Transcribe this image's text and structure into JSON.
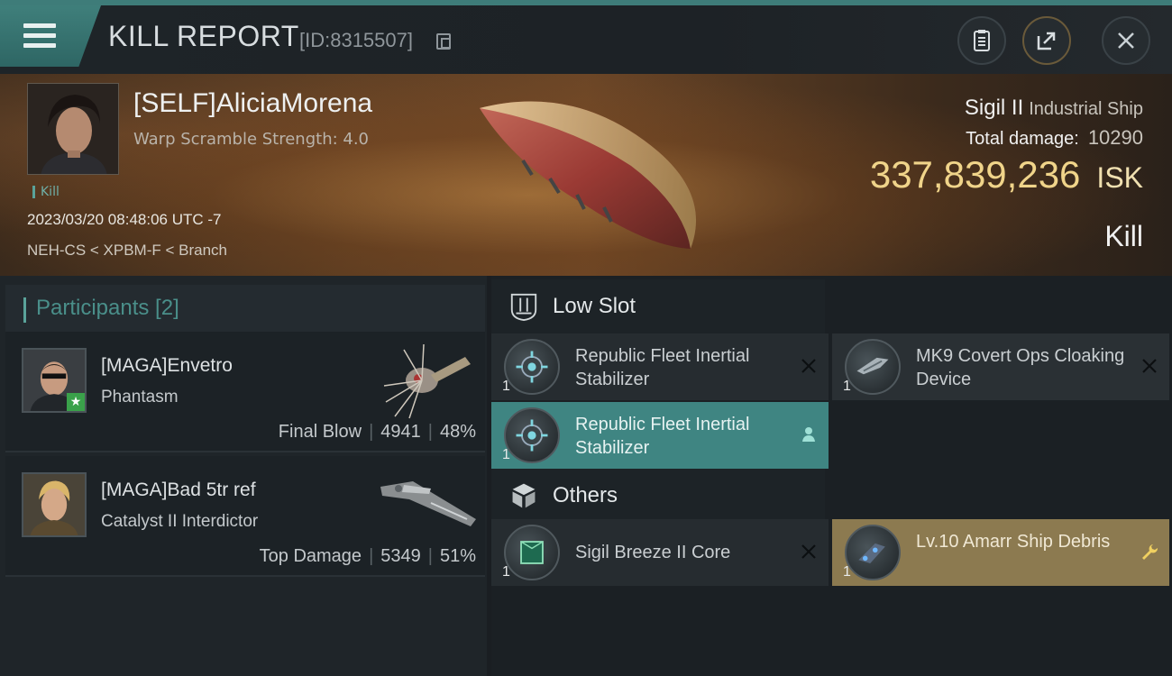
{
  "header": {
    "title": "KILL REPORT",
    "report_id": "[ID:8315507]"
  },
  "victim": {
    "pilot": "[SELF]AliciaMorena",
    "warp_scramble": "Warp Scramble Strength: 4.0",
    "tag": "Kill",
    "datetime": "2023/03/20 08:48:06 UTC -7",
    "location": "NEH-CS < XPBM-F < Branch",
    "ship_name": "Sigil II",
    "ship_class": "Industrial Ship",
    "total_damage_label": "Total damage:",
    "total_damage": "10290",
    "isk_value": "337,839,236",
    "isk_unit": "ISK",
    "result": "Kill"
  },
  "participants": {
    "header": "Participants [2]",
    "rows": [
      {
        "name": "[MAGA]Envetro",
        "ship": "Phantasm",
        "role": "Final Blow",
        "damage": "4941",
        "percent": "48%"
      },
      {
        "name": "[MAGA]Bad 5tr ref",
        "ship": "Catalyst II Interdictor",
        "role": "Top Damage",
        "damage": "5349",
        "percent": "51%"
      }
    ]
  },
  "items": {
    "low_slot_label": "Low Slot",
    "others_label": "Others",
    "low_slot": [
      {
        "name": "Republic Fleet Inertial Stabilizer",
        "qty": "1"
      },
      {
        "name": "MK9 Covert Ops Cloaking Device",
        "qty": "1"
      },
      {
        "name": "Republic Fleet Inertial Stabilizer",
        "qty": "1"
      }
    ],
    "others": [
      {
        "name": "Sigil Breeze II Core",
        "qty": "1"
      },
      {
        "name": "Lv.10 Amarr Ship Debris",
        "qty": "1"
      }
    ]
  },
  "colors": {
    "accent_teal": "#3f8582",
    "isk_gold": "#f0d48a",
    "highlight_gold": "#8c7a50"
  }
}
